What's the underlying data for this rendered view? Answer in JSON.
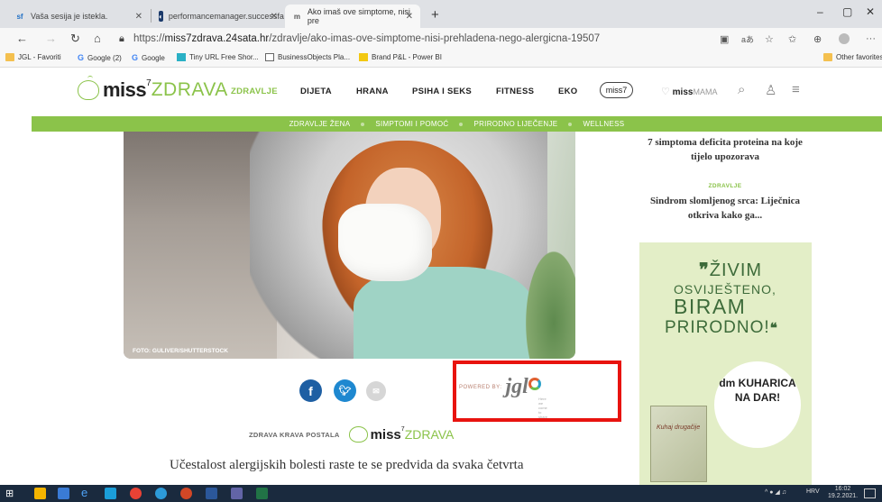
{
  "browser": {
    "tabs": [
      {
        "icon": "sf",
        "title": "Vaša sesija je istekla.",
        "active": false
      },
      {
        "icon": "sp",
        "title": "performancemanager.successfa",
        "active": false
      },
      {
        "icon": "m",
        "title": "Ako imaš ove simptome, nisi pre",
        "active": true
      }
    ],
    "new_tab": "+",
    "window_controls": [
      "–",
      "▢",
      "✕"
    ],
    "url_prefix": "https://",
    "url_domain": "miss7zdrava.24sata.hr",
    "url_path": "/zdravlje/ako-imas-ove-simptome-nisi-prehladena-nego-alergicna-19507",
    "favorites": [
      {
        "icon": "folder",
        "label": "JGL - Favoriti"
      },
      {
        "icon": "google",
        "label": "Google (2)"
      },
      {
        "icon": "google",
        "label": "Google"
      },
      {
        "icon": "tinyurl",
        "label": "Tiny URL  Free Shor..."
      },
      {
        "icon": "page",
        "label": "BusinessObjects Pla..."
      },
      {
        "icon": "powerbi",
        "label": "Brand P&L - Power BI"
      }
    ],
    "other_favorites": "Other favorites"
  },
  "site": {
    "logo": {
      "miss": "miss",
      "sup": "7",
      "zdrava": "ZDRAVA"
    },
    "menu": [
      "ZDRAVLJE",
      "DIJETA",
      "HRANA",
      "PSIHA I SEKS",
      "FITNESS",
      "EKO"
    ],
    "active_menu": "ZDRAVLJE",
    "miss7_badge": "miss7",
    "missmama": {
      "miss": "miss",
      "mama": "MAMA"
    },
    "subnav": [
      "ZDRAVLJE ŽENA",
      "SIMPTOMI I POMOĆ",
      "PRIRODNO LIJEČENJE",
      "WELLNESS"
    ]
  },
  "article": {
    "photo_credit": "FOTO: GULIVER/SHUTTERSTOCK",
    "share": {
      "facebook": "f",
      "twitter": "t",
      "email": "✉"
    },
    "powered_by": "POWERED BY:",
    "sponsor": "jgl",
    "sponsor_tag": "Here we come to share",
    "postala_label": "ZDRAVA KRAVA POSTALA",
    "postala_logo": {
      "miss": "miss",
      "sup": "7",
      "zdrava": "ZDRAVA"
    },
    "body_start": "Učestalost alergijskih bolesti raste te se predvida da svaka četvrta"
  },
  "sidebar": {
    "item1_title": "7 simptoma deficita proteina na koje tijelo upozorava",
    "item2_category": "ZDRAVLJE",
    "item2_title": "Sindrom slomljenog srca: Liječnica otkriva kako ga...",
    "ad": {
      "line1": "ŽIVIM",
      "line2": "OSVIJEŠTENO,",
      "line3": "BIRAM",
      "line4": "PRIRODNO!",
      "badge": "dm KUHARICA NA DAR!",
      "book_title": "Kuhaj drugačije"
    }
  },
  "taskbar": {
    "language": "HRV",
    "time": "16:02",
    "date": "19.2.2021."
  },
  "colors": {
    "brand_green": "#8bc34a",
    "highlight_red": "#e8130f",
    "taskbar": "#1a2a3e"
  }
}
